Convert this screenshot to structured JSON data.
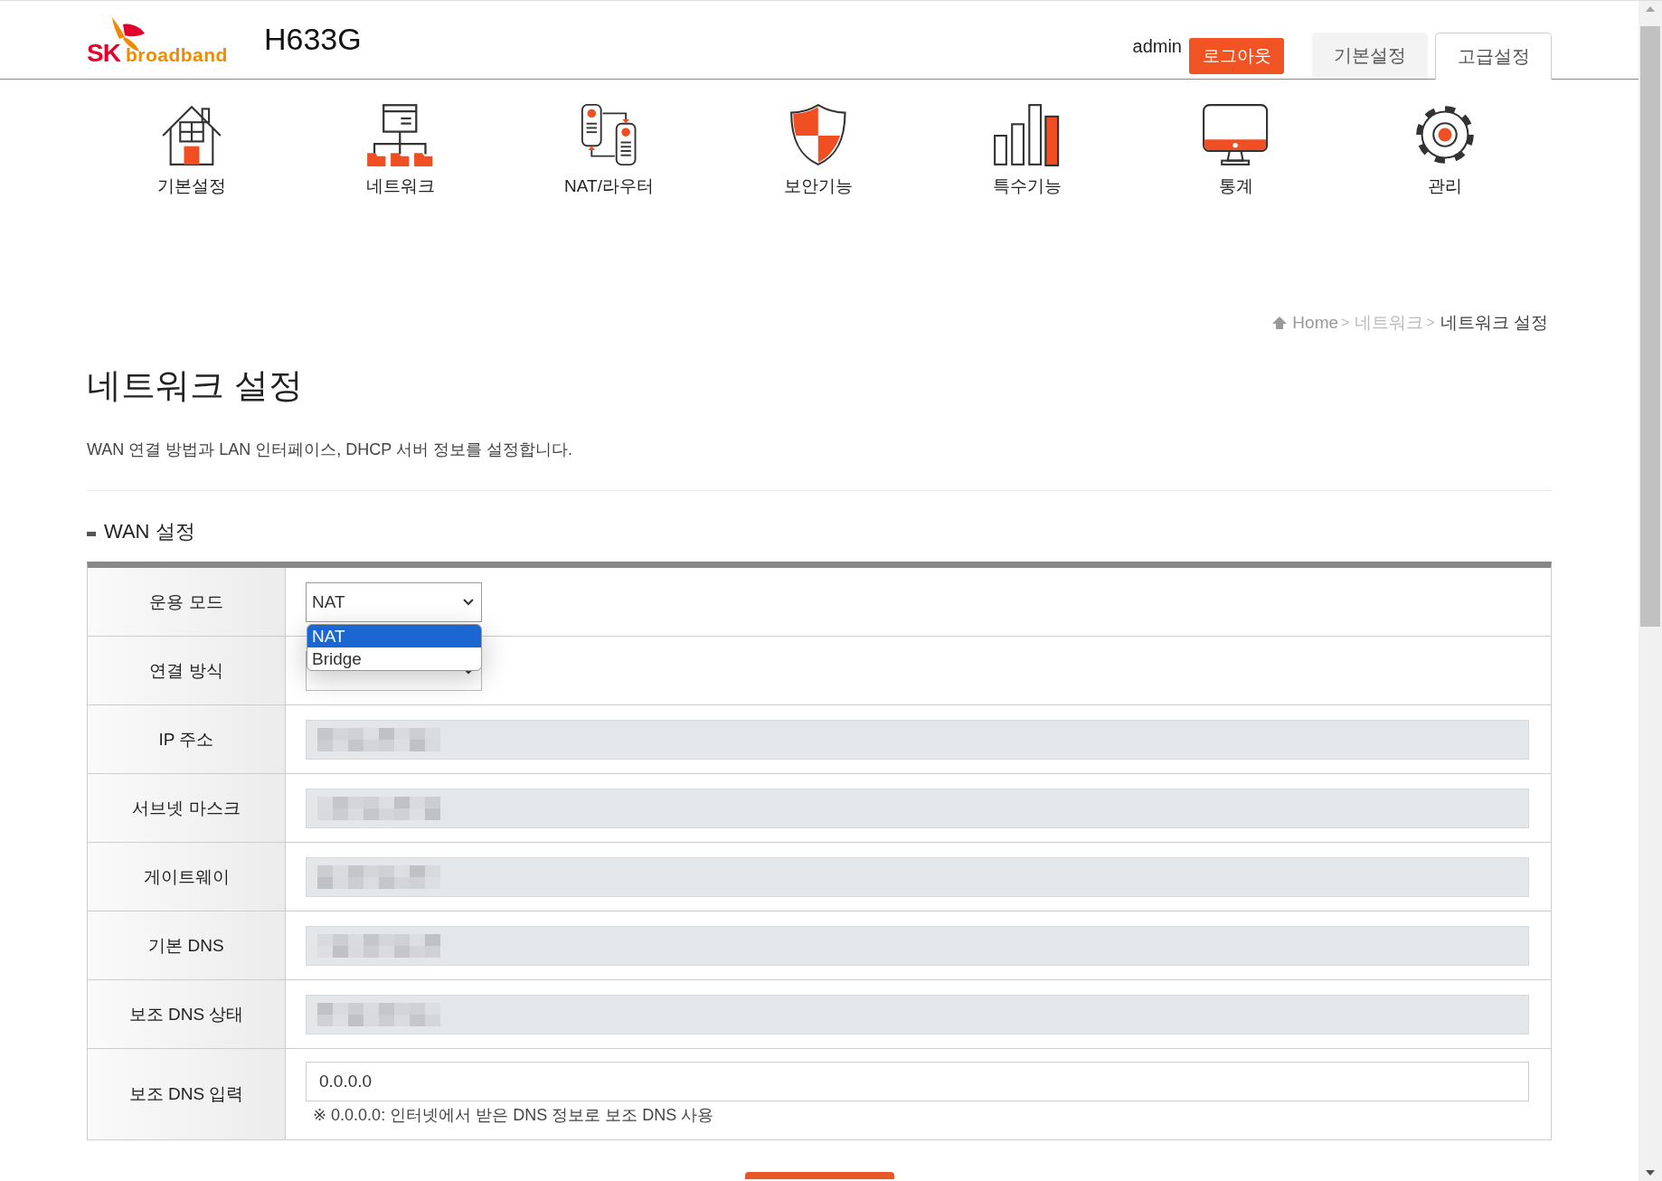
{
  "header": {
    "logo": {
      "mark": "SK",
      "text": "broadband"
    },
    "model": "H633G",
    "user": "admin",
    "logout": "로그아웃",
    "tabs": [
      {
        "label": "기본설정",
        "selected": false
      },
      {
        "label": "고급설정",
        "selected": true
      }
    ]
  },
  "nav": [
    {
      "label": "기본설정",
      "kind": "house"
    },
    {
      "label": "네트워크",
      "kind": "network"
    },
    {
      "label": "NAT/라우터",
      "kind": "router"
    },
    {
      "label": "보안기능",
      "kind": "shield"
    },
    {
      "label": "특수기능",
      "kind": "bars"
    },
    {
      "label": "통계",
      "kind": "monitor"
    },
    {
      "label": "관리",
      "kind": "gear"
    }
  ],
  "breadcrumb": {
    "items": [
      {
        "label": "Home",
        "current": false
      },
      {
        "label": "네트워크",
        "current": false
      },
      {
        "label": "네트워크 설정",
        "current": true
      }
    ],
    "separators": [
      ">",
      ">"
    ]
  },
  "page": {
    "title": "네트워크 설정",
    "description": "WAN 연결 방법과 LAN 인터페이스, DHCP 서버 정보를 설정합니다."
  },
  "section": {
    "title": "WAN 설정",
    "rows": [
      {
        "label": "운용 모드",
        "kind": "select",
        "value": "NAT",
        "expanded": true,
        "options": [
          {
            "label": "NAT",
            "selected": true
          },
          {
            "label": "Bridge",
            "selected": false
          }
        ]
      },
      {
        "label": "연결 방식",
        "kind": "select",
        "expanded": false
      },
      {
        "label": "IP 주소",
        "kind": "readonly",
        "redacted": true
      },
      {
        "label": "서브넷 마스크",
        "kind": "readonly",
        "redacted": true
      },
      {
        "label": "게이트웨이",
        "kind": "readonly",
        "redacted": true
      },
      {
        "label": "기본 DNS",
        "kind": "readonly",
        "redacted": true
      },
      {
        "label": "보조 DNS 상태",
        "kind": "readonly",
        "redacted": true
      },
      {
        "label": "보조 DNS 입력",
        "kind": "input",
        "value": "0.0.0.0",
        "note": "※ 0.0.0.0: 인터넷에서 받은 DNS 정보로 보조 DNS 사용"
      }
    ]
  },
  "buttons": [
    {
      "kind": "primary"
    }
  ]
}
